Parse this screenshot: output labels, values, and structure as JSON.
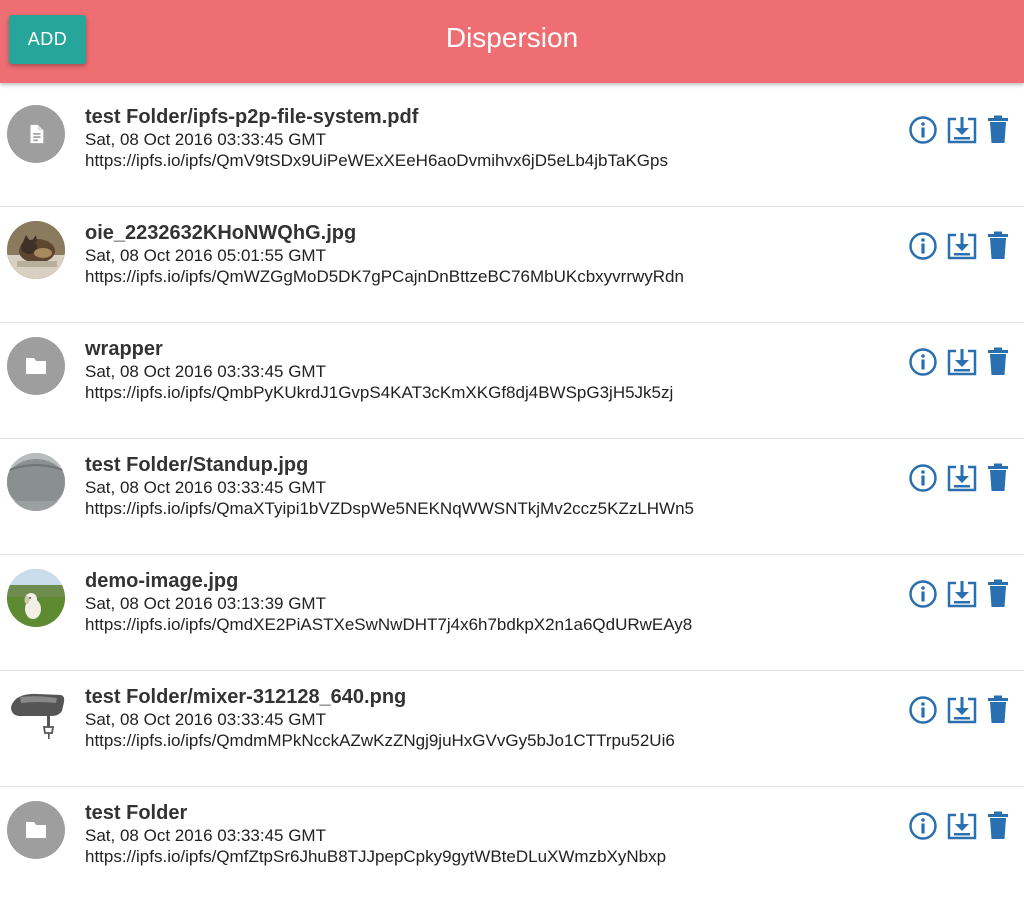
{
  "header": {
    "add_label": "ADD",
    "title": "Dispersion",
    "bg_color": "#ee6e73",
    "add_color": "#26a69a"
  },
  "actions": {
    "info_icon": "info-icon",
    "download_icon": "download-icon",
    "delete_icon": "trash-icon",
    "icon_color": "#2a6fb0"
  },
  "files": [
    {
      "name": "test Folder/ipfs-p2p-file-system.pdf",
      "date": "Sat, 08 Oct 2016 03:33:45 GMT",
      "url": "https://ipfs.io/ipfs/QmV9tSDx9UiPeWExXEeH6aoDvmihvx6jD5eLb4jbTaKGps",
      "icon": "document-icon"
    },
    {
      "name": "oie_2232632KHoNWQhG.jpg",
      "date": "Sat, 08 Oct 2016 05:01:55 GMT",
      "url": "https://ipfs.io/ipfs/QmWZGgMoD5DK7gPCajnDnBttzeBC76MbUKcbxyvrrwyRdn",
      "icon": "cat-thumbnail"
    },
    {
      "name": "wrapper",
      "date": "Sat, 08 Oct 2016 03:33:45 GMT",
      "url": "https://ipfs.io/ipfs/QmbPyKUkrdJ1GvpS4KAT3cKmXKGf8dj4BWSpG3jH5Jk5zj",
      "icon": "folder-icon"
    },
    {
      "name": "test Folder/Standup.jpg",
      "date": "Sat, 08 Oct 2016 03:33:45 GMT",
      "url": "https://ipfs.io/ipfs/QmaXTyipi1bVZDspWe5NEKNqWWSNTkjMv2ccz5KZzLHWn5",
      "icon": "standup-thumbnail"
    },
    {
      "name": "demo-image.jpg",
      "date": "Sat, 08 Oct 2016 03:13:39 GMT",
      "url": "https://ipfs.io/ipfs/QmdXE2PiASTXeSwNwDHT7j4x6h7bdkpX2n1a6QdURwEAy8",
      "icon": "dog-thumbnail"
    },
    {
      "name": "test Folder/mixer-312128_640.png",
      "date": "Sat, 08 Oct 2016 03:33:45 GMT",
      "url": "https://ipfs.io/ipfs/QmdmMPkNcckAZwKzZNgj9juHxGVvGy5bJo1CTTrpu52Ui6",
      "icon": "mixer-thumbnail"
    },
    {
      "name": "test Folder",
      "date": "Sat, 08 Oct 2016 03:33:45 GMT",
      "url": "https://ipfs.io/ipfs/QmfZtpSr6JhuB8TJJpepCpky9gytWBteDLuXWmzbXyNbxp",
      "icon": "folder-icon"
    }
  ]
}
